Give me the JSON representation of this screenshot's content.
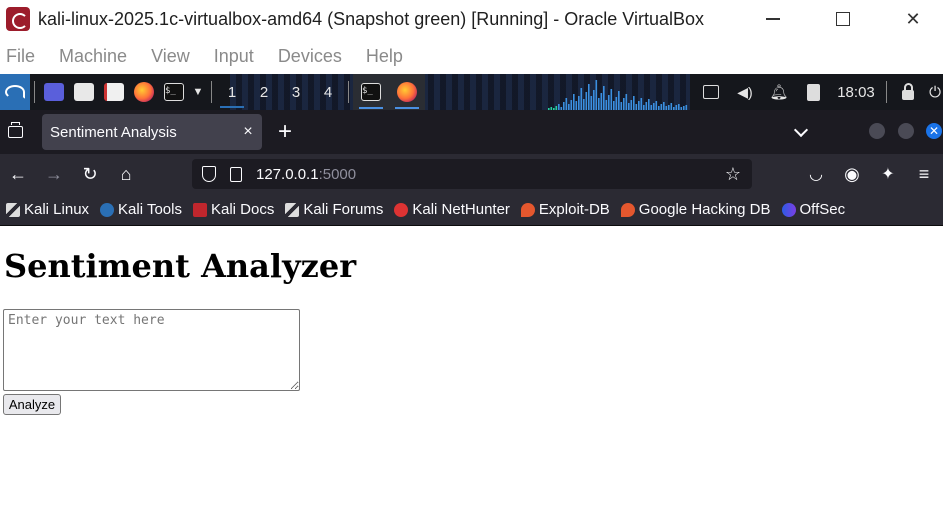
{
  "vbox": {
    "title": "kali-linux-2025.1c-virtualbox-amd64 (Snapshot green) [Running] - Oracle VirtualBox",
    "menu": [
      "File",
      "Machine",
      "View",
      "Input",
      "Devices",
      "Help"
    ],
    "controls": {
      "close": "✕"
    }
  },
  "kali_panel": {
    "workspaces": [
      "1",
      "2",
      "3",
      "4"
    ],
    "active_workspace": "1",
    "terminal_glyph": "$_",
    "clock": "18:03",
    "accent": "#2a6fb5"
  },
  "firefox": {
    "tab": {
      "title": "Sentiment Analysis",
      "close": "×"
    },
    "new_tab": "+",
    "url": {
      "host": "127.0.0.1",
      "port": ":5000"
    },
    "bookmarks": [
      {
        "label": "Kali Linux",
        "icon": "kali-dragon-icon"
      },
      {
        "label": "Kali Tools",
        "icon": "kali-tools-icon"
      },
      {
        "label": "Kali Docs",
        "icon": "kali-docs-icon"
      },
      {
        "label": "Kali Forums",
        "icon": "kali-dragon-icon"
      },
      {
        "label": "Kali NetHunter",
        "icon": "nethunter-icon"
      },
      {
        "label": "Exploit-DB",
        "icon": "exploit-db-icon"
      },
      {
        "label": "Google Hacking DB",
        "icon": "exploit-db-icon"
      },
      {
        "label": "OffSec",
        "icon": "offsec-icon"
      }
    ]
  },
  "page": {
    "heading": "Sentiment Analyzer",
    "textarea_placeholder": "Enter your text here",
    "textarea_value": "",
    "analyze_label": "Analyze"
  }
}
